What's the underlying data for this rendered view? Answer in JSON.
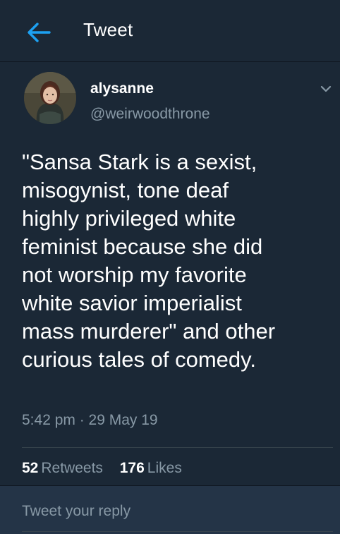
{
  "header": {
    "title": "Tweet",
    "back_icon": "arrow-left-icon"
  },
  "tweet": {
    "display_name": "alysanne",
    "handle": "@weirwoodthrone",
    "text": "\"Sansa Stark is a sexist,\nmisogynist, tone deaf\nhighly privileged white\nfeminist because she did\nnot worship my favorite\nwhite savior imperialist\nmass murderer\" and other\ncurious tales of comedy.",
    "timestamp": "5:42 pm · 29 May 19",
    "retweets_count": "52",
    "retweets_label": "Retweets",
    "likes_count": "176",
    "likes_label": "Likes"
  },
  "reply": {
    "placeholder": "Tweet your reply"
  },
  "colors": {
    "background": "#1b2836",
    "accent": "#1da1f2",
    "muted_text": "#8899a6",
    "divider": "#38444d",
    "reply_bar": "#243447"
  }
}
